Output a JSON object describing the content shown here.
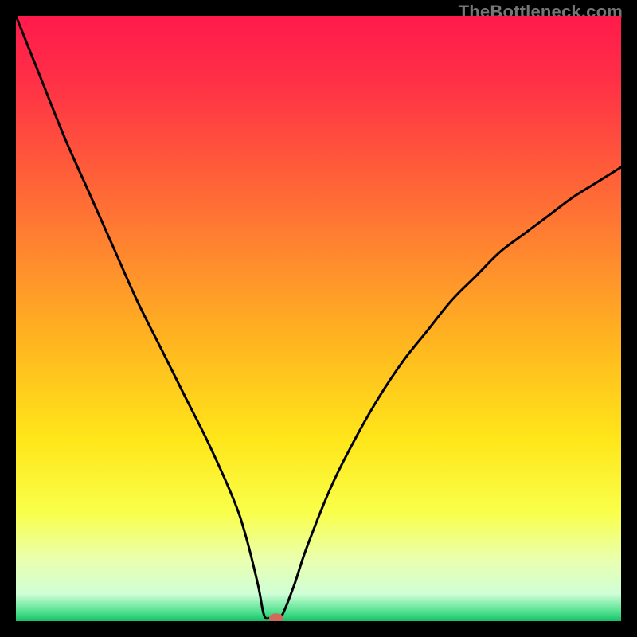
{
  "watermark": "TheBottleneck.com",
  "chart_data": {
    "type": "line",
    "title": "",
    "xlabel": "",
    "ylabel": "",
    "xlim": [
      0,
      100
    ],
    "ylim": [
      0,
      100
    ],
    "grid": false,
    "series": [
      {
        "name": "curve",
        "x": [
          0,
          4,
          8,
          12,
          16,
          20,
          24,
          28,
          32,
          36,
          38,
          40,
          41,
          42,
          43,
          44,
          46,
          48,
          52,
          56,
          60,
          64,
          68,
          72,
          76,
          80,
          84,
          88,
          92,
          96,
          100
        ],
        "y": [
          100,
          90,
          80,
          71,
          62,
          53,
          45,
          37,
          29,
          20,
          14,
          6,
          1,
          0.5,
          0.5,
          1,
          6,
          12,
          22,
          30,
          37,
          43,
          48,
          53,
          57,
          61,
          64,
          67,
          70,
          72.5,
          75
        ]
      }
    ],
    "marker": {
      "x": 43,
      "y": 0.5,
      "color": "#d16a5a"
    },
    "gradient_stops": [
      {
        "offset": 0.0,
        "color": "#ff1a4b"
      },
      {
        "offset": 0.1,
        "color": "#ff2e47"
      },
      {
        "offset": 0.25,
        "color": "#ff5b3a"
      },
      {
        "offset": 0.4,
        "color": "#ff8a2e"
      },
      {
        "offset": 0.55,
        "color": "#ffb91f"
      },
      {
        "offset": 0.7,
        "color": "#ffe61a"
      },
      {
        "offset": 0.82,
        "color": "#f9ff4a"
      },
      {
        "offset": 0.9,
        "color": "#eaffb0"
      },
      {
        "offset": 0.955,
        "color": "#cfffd6"
      },
      {
        "offset": 0.985,
        "color": "#4fe08e"
      },
      {
        "offset": 1.0,
        "color": "#17c06a"
      }
    ]
  }
}
